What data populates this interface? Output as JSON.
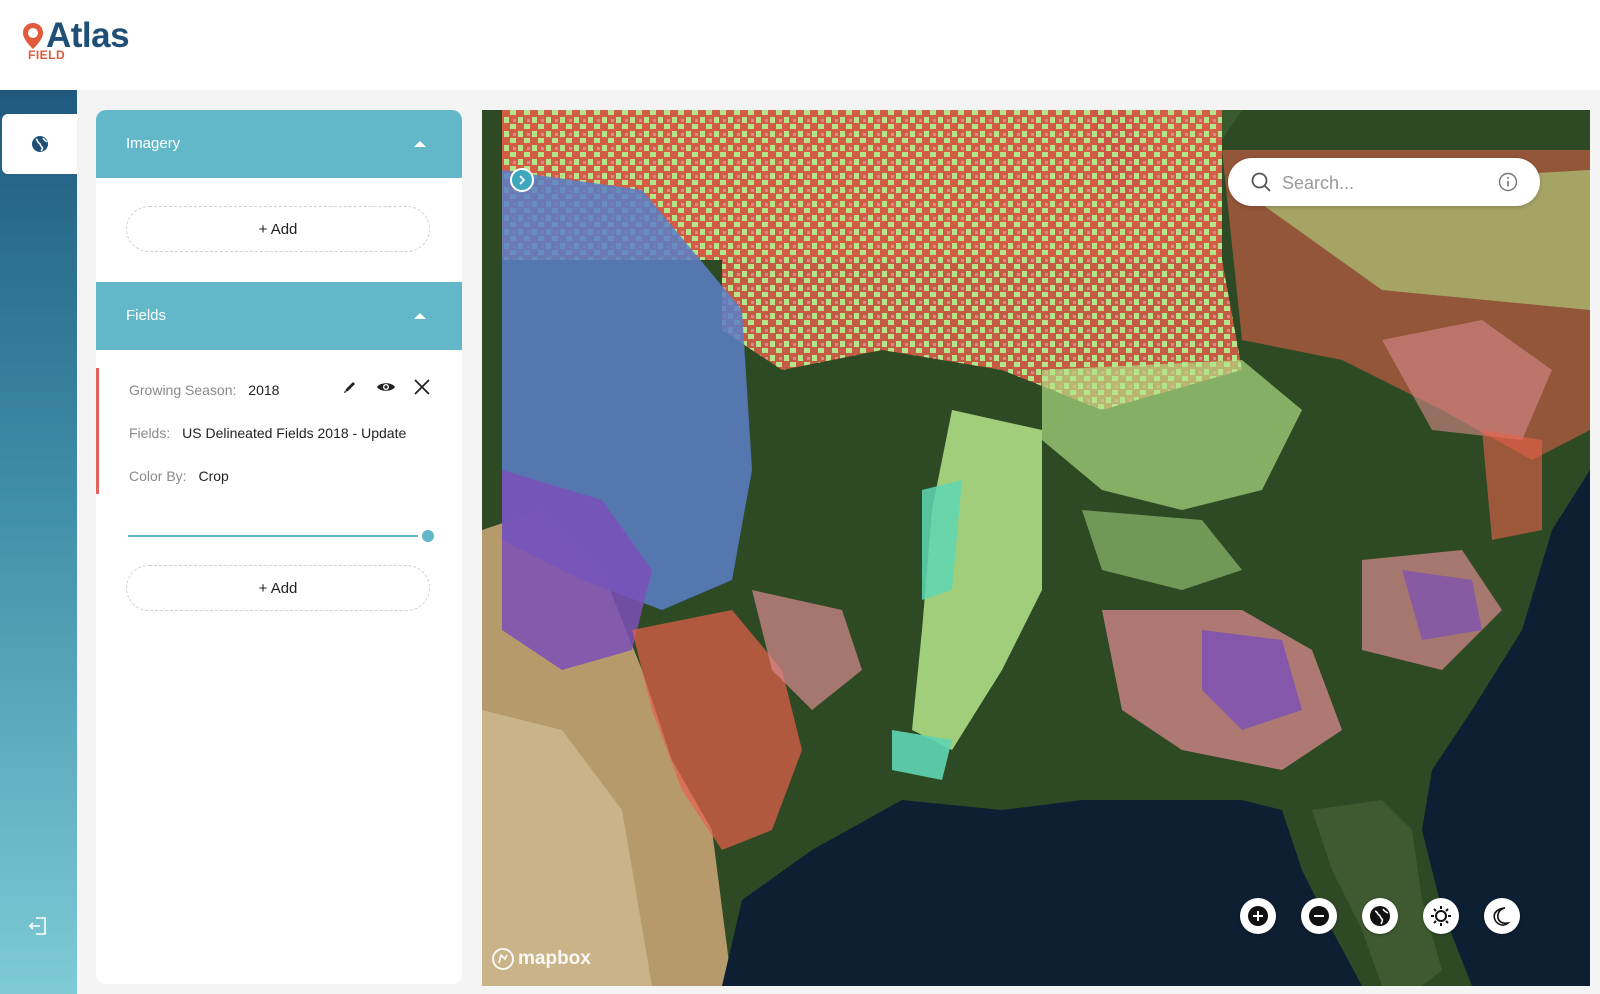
{
  "header": {
    "logo_text": "Atlas",
    "logo_sub": "FIELD"
  },
  "panel": {
    "imagery": {
      "title": "Imagery",
      "add_label": "+ Add"
    },
    "fields": {
      "title": "Fields",
      "layer": {
        "season_label": "Growing Season:",
        "season_value": "2018",
        "fields_label": "Fields:",
        "fields_value": "US Delineated Fields 2018 - Update",
        "color_label": "Color By:",
        "color_value": "Crop",
        "opacity": 1.0
      },
      "add_label": "+ Add"
    }
  },
  "map": {
    "search": {
      "placeholder": "Search..."
    },
    "attribution": "mapbox",
    "colors": {
      "corn": "#e8604a",
      "soy": "#b5e58a",
      "wheat": "#5b7fc8",
      "cotton": "#7b4fb8",
      "rice": "#5fd6b4",
      "hay": "#d98a8e",
      "forest": "#2e4a24",
      "water": "#0e1f33",
      "desert": "#b69a6c"
    }
  }
}
